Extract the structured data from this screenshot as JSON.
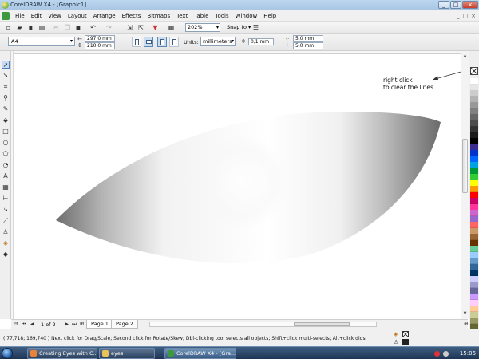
{
  "window": {
    "title": "CorelDRAW X4 - [Graphic1]",
    "controls": [
      "_",
      "□",
      "×"
    ],
    "doc_controls": [
      "_",
      "□",
      "×"
    ]
  },
  "menu": [
    "File",
    "Edit",
    "View",
    "Layout",
    "Arrange",
    "Effects",
    "Bitmaps",
    "Text",
    "Table",
    "Tools",
    "Window",
    "Help"
  ],
  "standard_toolbar": {
    "zoom_level": "202%",
    "snap_to_label": "Snap to",
    "icons": [
      "new-document-icon",
      "open-icon",
      "save-icon",
      "print-icon",
      "cut-icon",
      "copy-icon",
      "paste-icon",
      "undo-icon",
      "redo-icon",
      "import-icon",
      "export-icon",
      "application-launcher-icon",
      "welcome-screen-icon",
      "options-icon"
    ]
  },
  "property_bar": {
    "page_size": "A4",
    "width": "297,0 mm",
    "height": "210,0 mm",
    "units_label": "Units:",
    "units": "millimeters",
    "nudge": "0,1 mm",
    "duplicate_x": "5,0 mm",
    "duplicate_y": "5,0 mm"
  },
  "toolbox": [
    "pick-tool-icon",
    "shape-tool-icon",
    "crop-tool-icon",
    "zoom-tool-icon",
    "freehand-tool-icon",
    "smart-fill-tool-icon",
    "rectangle-tool-icon",
    "ellipse-tool-icon",
    "polygon-tool-icon",
    "basic-shapes-tool-icon",
    "text-tool-icon",
    "table-tool-icon",
    "dimension-tool-icon",
    "connector-tool-icon",
    "eyedropper-tool-icon",
    "outline-tool-icon",
    "fill-tool-icon",
    "interactive-fill-tool-icon"
  ],
  "annotation": {
    "line1": "right click",
    "line2": "to clear the lines"
  },
  "palette": {
    "no_fill_icon": "x-icon",
    "colors": [
      "#ffffff",
      "#e6e6e6",
      "#cccccc",
      "#b3b3b3",
      "#999999",
      "#808080",
      "#666666",
      "#4d4d4d",
      "#333333",
      "#1a1a1a",
      "#000000",
      "#3b2d8f",
      "#0033cc",
      "#0066ff",
      "#00a3e0",
      "#009933",
      "#33cc33",
      "#ffff00",
      "#ff9900",
      "#ff0000",
      "#cc0066",
      "#ff3399",
      "#cc66cc",
      "#9966cc",
      "#ff6666",
      "#cc9966",
      "#996633",
      "#663300",
      "#66cc99",
      "#99ccff",
      "#6699cc",
      "#336699",
      "#003366",
      "#ccccff",
      "#9999cc",
      "#666699",
      "#cc99ff",
      "#ffccff",
      "#ffcc99",
      "#cccc99",
      "#999966",
      "#666633"
    ]
  },
  "page_nav": {
    "count": "1 of 2",
    "tabs": [
      "Page 1",
      "Page 2"
    ]
  },
  "status": {
    "coords": "( 77,718; 169,740 )",
    "hint": "Next click for Drag/Scale; Second click for Rotate/Skew; Dbl-clicking tool selects all objects; Shift+click multi-selects; Alt+click digs"
  },
  "taskbar": {
    "items": [
      "Creating Eyes with C...",
      "eyes",
      "CorelDRAW X4 - [Gra..."
    ],
    "clock": "15:06"
  }
}
